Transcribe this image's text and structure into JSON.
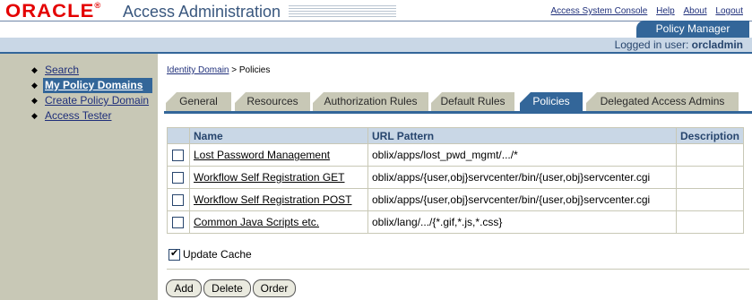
{
  "header": {
    "logo": "ORACLE",
    "logo_mark": "®",
    "title": "Access Administration",
    "links": [
      "Access System Console",
      "Help",
      "About",
      "Logout"
    ],
    "section_tab": "Policy Manager",
    "logged_in_label": "Logged in user:",
    "logged_in_user": "orcladmin"
  },
  "sidebar": {
    "items": [
      {
        "label": "Search"
      },
      {
        "label": "My Policy Domains"
      },
      {
        "label": "Create Policy Domain"
      },
      {
        "label": "Access Tester"
      }
    ]
  },
  "breadcrumb": {
    "parent": "Identity Domain",
    "separator": ">",
    "current": "Policies"
  },
  "tabs": {
    "items": [
      "General",
      "Resources",
      "Authorization Rules",
      "Default Rules",
      "Policies",
      "Delegated Access Admins"
    ],
    "active": "Policies"
  },
  "table": {
    "headers": [
      "Name",
      "URL Pattern",
      "Description"
    ],
    "rows": [
      {
        "name": "Lost Password Management",
        "url": "oblix/apps/lost_pwd_mgmt/.../*",
        "description": ""
      },
      {
        "name": "Workflow Self Registration GET",
        "url": "oblix/apps/{user,obj}servcenter/bin/{user,obj}servcenter.cgi",
        "description": ""
      },
      {
        "name": "Workflow Self Registration POST",
        "url": "oblix/apps/{user,obj}servcenter/bin/{user,obj}servcenter.cgi",
        "description": ""
      },
      {
        "name": "Common Java Scripts etc.",
        "url": "oblix/lang/.../{*.gif,*.js,*.css}",
        "description": ""
      }
    ]
  },
  "update_cache": {
    "label": "Update Cache",
    "checked": true
  },
  "buttons": {
    "add": "Add",
    "delete": "Delete",
    "order": "Order"
  },
  "colors": {
    "accent": "#336699",
    "sidebar": "#c8c8b6",
    "header_fill": "#c9d7e6",
    "logo": "#e40000"
  }
}
